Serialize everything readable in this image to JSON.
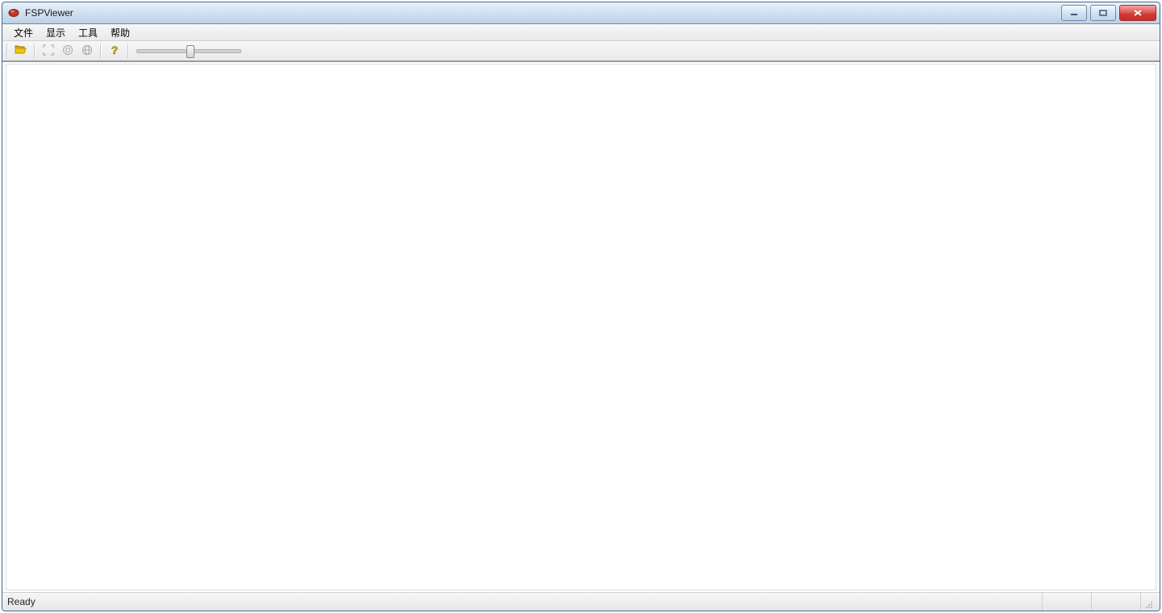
{
  "window": {
    "title": "FSPViewer"
  },
  "menu": {
    "items": [
      "文件",
      "显示",
      "工具",
      "帮助"
    ]
  },
  "toolbar": {
    "open_icon": "open-folder-icon",
    "fullscreen_icon": "fullscreen-icon",
    "target_icon": "target-icon",
    "globe_icon": "globe-icon",
    "help_icon": "help-icon"
  },
  "slider": {
    "value_percent": 50
  },
  "status": {
    "text": "Ready"
  }
}
